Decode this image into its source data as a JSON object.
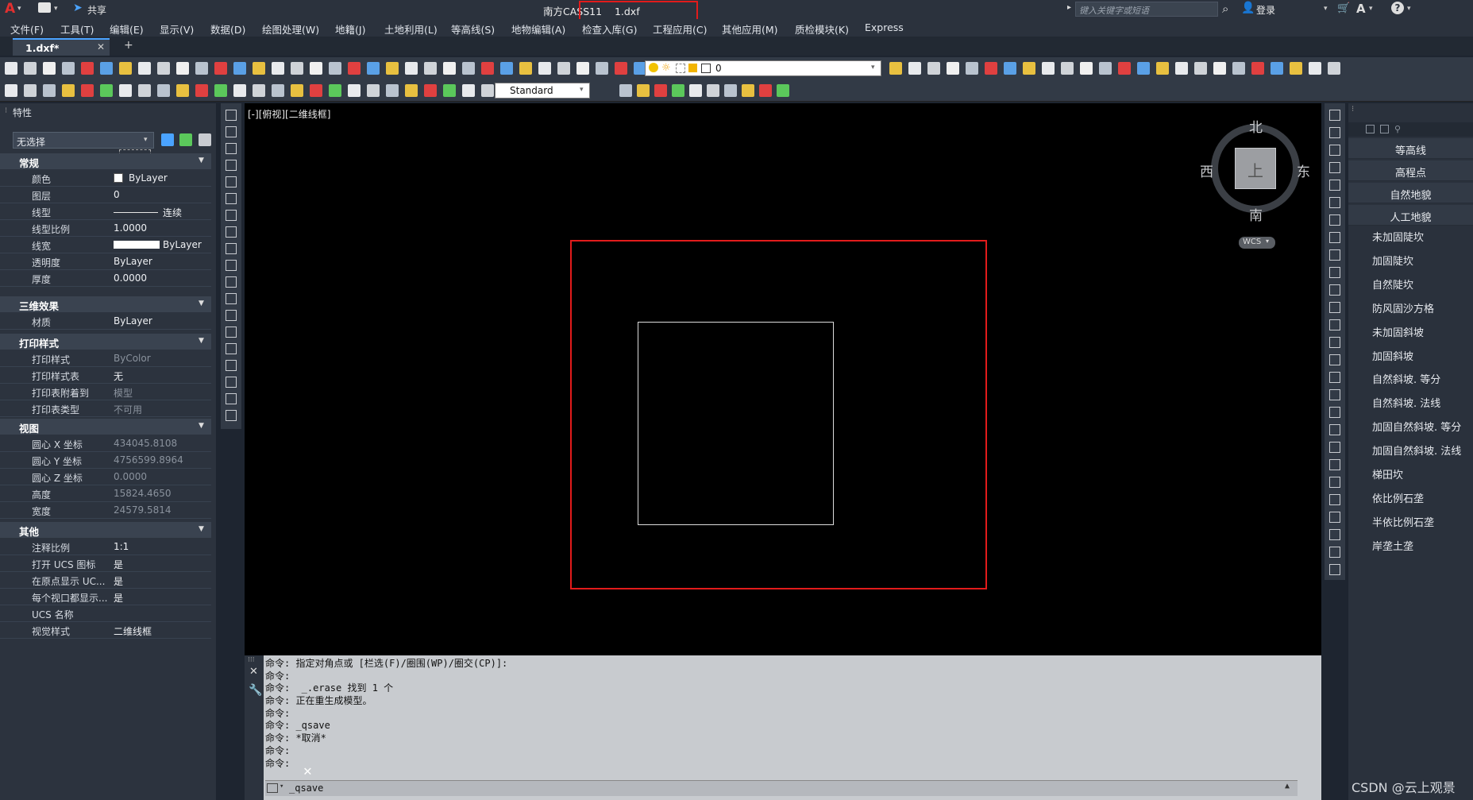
{
  "window": {
    "app_menu_logo": "A",
    "share_label": "共享",
    "title": "南方CASS11    1.dxf",
    "search_placeholder": "键入关键字或短语",
    "login_label": "登录"
  },
  "menu": [
    "文件(F)",
    "工具(T)",
    "编辑(E)",
    "显示(V)",
    "数据(D)",
    "绘图处理(W)",
    "地籍(J)",
    "土地利用(L)",
    "等高线(S)",
    "地物编辑(A)",
    "检查入库(G)",
    "工程应用(C)",
    "其他应用(M)",
    "质检模块(K)",
    "Express"
  ],
  "tabs": {
    "active": "1.dxf*",
    "add": "+"
  },
  "toolbar": {
    "layer_value": "0",
    "text_style": "Standard"
  },
  "properties": {
    "title": "特性",
    "selection": "无选择",
    "sections": [
      {
        "name": "常规",
        "rows": [
          {
            "k": "颜色",
            "v": "ByLayer"
          },
          {
            "k": "图层",
            "v": "0"
          },
          {
            "k": "线型",
            "v": "连续"
          },
          {
            "k": "线型比例",
            "v": "1.0000"
          },
          {
            "k": "线宽",
            "v": "ByLayer"
          },
          {
            "k": "透明度",
            "v": "ByLayer"
          },
          {
            "k": "厚度",
            "v": "0.0000"
          }
        ]
      },
      {
        "name": "三维效果",
        "rows": [
          {
            "k": "材质",
            "v": "ByLayer"
          }
        ]
      },
      {
        "name": "打印样式",
        "rows": [
          {
            "k": "打印样式",
            "v": "ByColor"
          },
          {
            "k": "打印样式表",
            "v": "无"
          },
          {
            "k": "打印表附着到",
            "v": "模型"
          },
          {
            "k": "打印表类型",
            "v": "不可用"
          }
        ]
      },
      {
        "name": "视图",
        "rows": [
          {
            "k": "圆心 X 坐标",
            "v": "434045.8108"
          },
          {
            "k": "圆心 Y 坐标",
            "v": "4756599.8964"
          },
          {
            "k": "圆心 Z 坐标",
            "v": "0.0000"
          },
          {
            "k": "高度",
            "v": "15824.4650"
          },
          {
            "k": "宽度",
            "v": "24579.5814"
          }
        ]
      },
      {
        "name": "其他",
        "rows": [
          {
            "k": "注释比例",
            "v": "1:1"
          },
          {
            "k": "打开 UCS 图标",
            "v": "是"
          },
          {
            "k": "在原点显示 UC...",
            "v": "是"
          },
          {
            "k": "每个视口都显示...",
            "v": "是"
          },
          {
            "k": "UCS 名称",
            "v": ""
          },
          {
            "k": "视觉样式",
            "v": "二维线框"
          }
        ]
      }
    ]
  },
  "viewport": {
    "label": "[-][俯视][二维线框]",
    "compass": {
      "n": "北",
      "s": "南",
      "e": "东",
      "w": "西",
      "top": "上",
      "wcs": "WCS"
    }
  },
  "command": {
    "log": [
      "命令: 指定对角点或 [栏选(F)/圈围(WP)/圈交(CP)]:",
      "命令:",
      "命令:  _.erase 找到 1 个",
      "命令: 正在重生成模型。",
      "命令:",
      "命令: _qsave",
      "命令: *取消*",
      "命令:",
      "命令:"
    ],
    "input": "_qsave"
  },
  "palette": {
    "headers": [
      "等高线",
      "高程点",
      "自然地貌",
      "人工地貌"
    ],
    "items": [
      "未加固陡坎",
      "加固陡坎",
      "自然陡坎",
      "防风固沙方格",
      "未加固斜坡",
      "加固斜坡",
      "自然斜坡. 等分",
      "自然斜坡. 法线",
      "加固自然斜坡. 等分",
      "加固自然斜坡. 法线",
      "梯田坎",
      "依比例石垄",
      "半依比例石垄",
      "岸垄土垄"
    ]
  },
  "watermark": "CSDN @云上观景",
  "colors": {
    "highlight": "#e21b1b",
    "canvas": "#000000",
    "panel": "#2c333e"
  }
}
